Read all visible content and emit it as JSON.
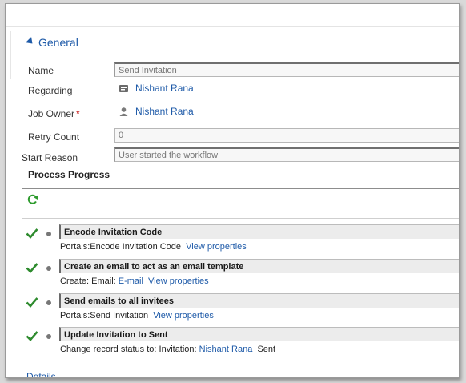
{
  "section": {
    "title": "General"
  },
  "fields": {
    "name": {
      "label": "Name",
      "value": "Send Invitation"
    },
    "regarding": {
      "label": "Regarding",
      "value": "Nishant Rana"
    },
    "job_owner": {
      "label": "Job Owner",
      "required_mark": "*",
      "value": "Nishant Rana"
    },
    "retry_count": {
      "label": "Retry Count",
      "value": "0"
    },
    "start_reason": {
      "label": "Start Reason",
      "value": "User started the workflow"
    }
  },
  "process": {
    "title": "Process Progress",
    "steps": [
      {
        "title": "Encode Invitation Code",
        "prefix": "Portals:Encode Invitation Code",
        "link": "View properties"
      },
      {
        "title": "Create an email to act as an email template",
        "prefix": "Create:  Email: ",
        "entity_link": "E-mail",
        "link": "View properties"
      },
      {
        "title": "Send emails to all invitees",
        "prefix": "Portals:Send Invitation",
        "link": "View properties"
      },
      {
        "title": "Update Invitation to Sent",
        "prefix": "Change record status to:  Invitation: ",
        "record_link": "Nishant Rana",
        "suffix": "Sent"
      }
    ]
  },
  "details": {
    "title": "Details"
  },
  "colors": {
    "accent": "#1e5aa8",
    "success": "#2e8b2e",
    "required": "#c00000"
  },
  "icons": {
    "collapse": "triangle-down-icon",
    "regarding": "record-icon",
    "owner": "user-icon",
    "refresh": "refresh-icon",
    "status": "checkmark-icon"
  }
}
